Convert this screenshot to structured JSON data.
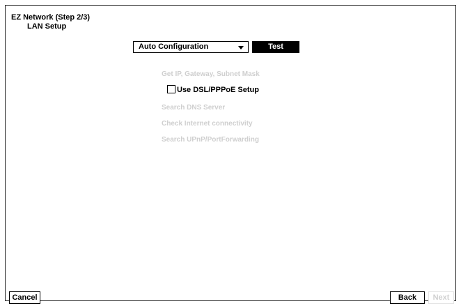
{
  "header": {
    "title": "EZ Network (Step 2/3)",
    "subtitle": "LAN Setup"
  },
  "config": {
    "mode_value": "Auto Configuration",
    "test_label": "Test"
  },
  "steps": {
    "get_ip": "Get IP, Gateway, Subnet Mask",
    "dsl_label": "Use DSL/PPPoE Setup",
    "dsl_checked": false,
    "search_dns": "Search DNS Server",
    "check_internet": "Check Internet connectivity",
    "search_upnp": "Search UPnP/PortForwarding"
  },
  "footer": {
    "cancel_label": "Cancel",
    "back_label": "Back",
    "next_label": "Next"
  },
  "colors": {
    "background": "#ffffff",
    "border": "#2a2a2a",
    "test_button": "#000000",
    "disabled_text": "#cfcfcf"
  }
}
